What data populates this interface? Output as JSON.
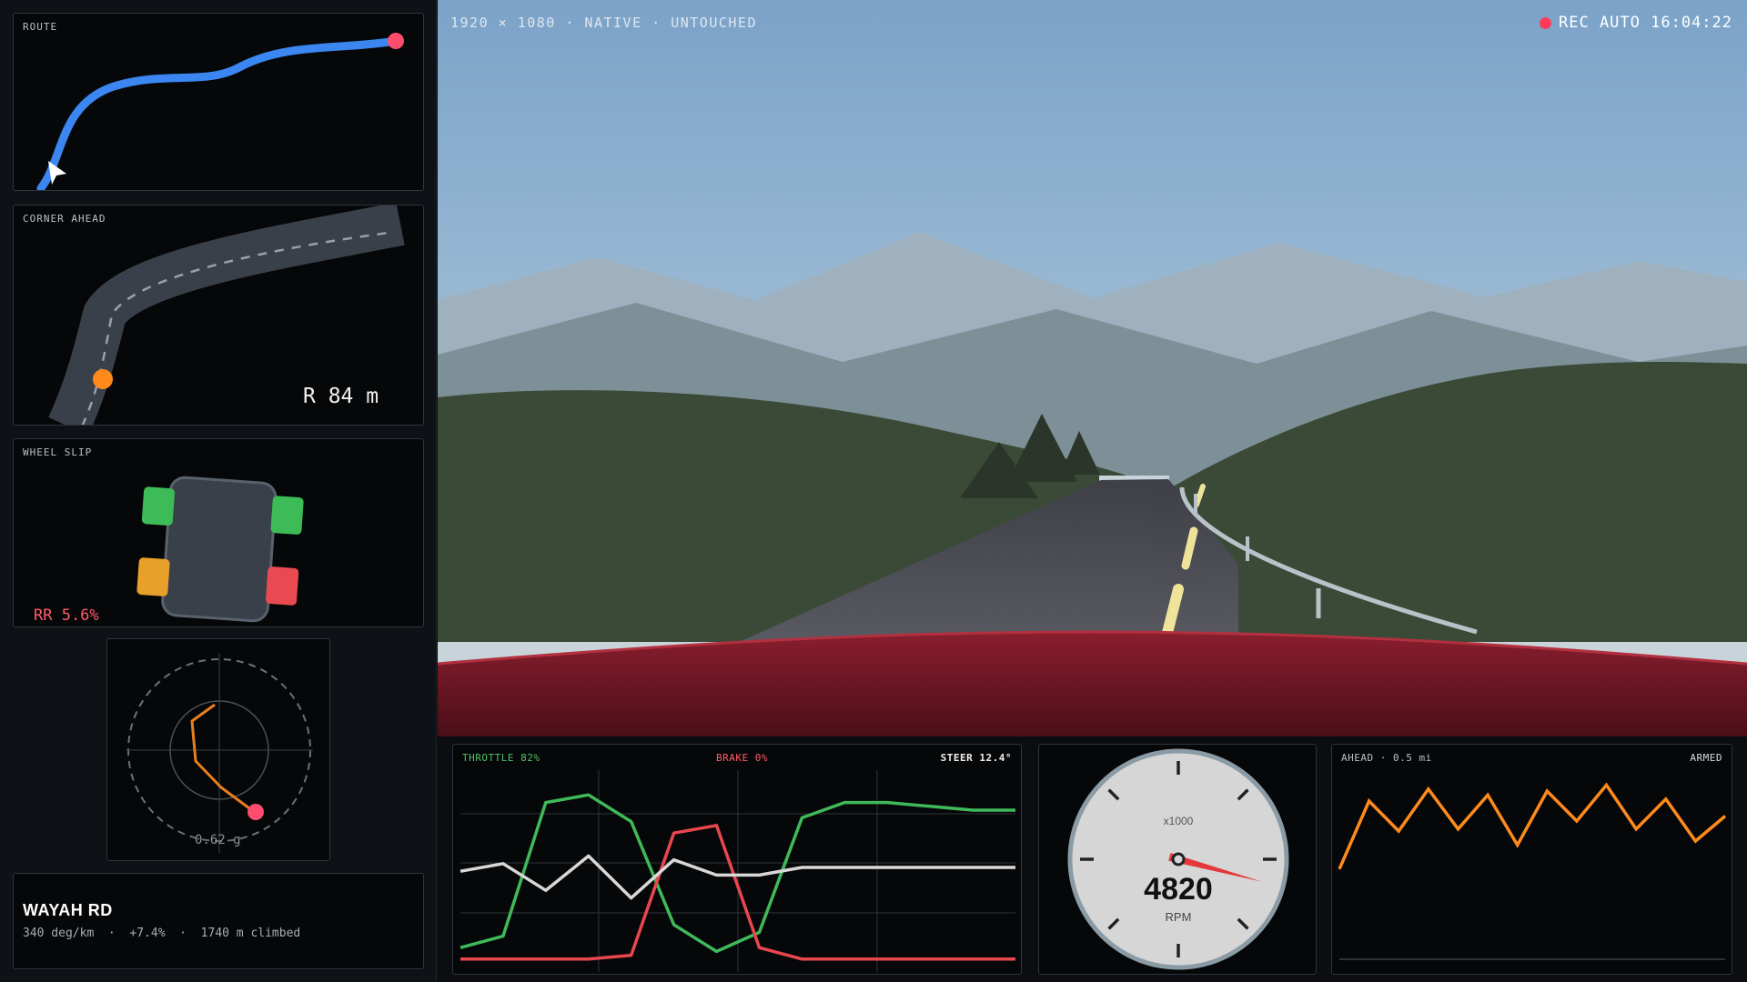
{
  "sidebar": {
    "route": {
      "label": "ROUTE"
    },
    "corner": {
      "label": "CORNER AHEAD",
      "radius": "R 84 m"
    },
    "wheel_slip": {
      "label": "WHEEL SLIP",
      "readout": "RR 5.6%",
      "wheels": {
        "FL": "#3dbb57",
        "FR": "#3dbb57",
        "RL": "#e7a02a",
        "RR": "#e94a52"
      }
    },
    "g_meter": {
      "readout": "0.62 g"
    },
    "road": {
      "name": "WAYAH RD",
      "stats": "340 deg/km  ·  +7.4%  ·  1740 m climbed"
    }
  },
  "scene": {
    "caption": "1920 × 1080 · NATIVE · UNTOUCHED",
    "rec": "REC AUTO 16:04:22"
  },
  "telemetry": {
    "throttle_label": "THROTTLE 82%",
    "brake_label": "BRAKE 0%",
    "steer_label": "STEER 12.4°",
    "chart_data": {
      "type": "line",
      "x": [
        0,
        1,
        2,
        3,
        4,
        5,
        6,
        7,
        8,
        9,
        10,
        11,
        12,
        13
      ],
      "ylim": [
        0,
        100
      ],
      "series": [
        {
          "color": "#3fb95a",
          "values": [
            8,
            14,
            84,
            88,
            74,
            20,
            6,
            16,
            76,
            84,
            84,
            82,
            80,
            80
          ]
        },
        {
          "color": "#e8474f",
          "values": [
            2,
            2,
            2,
            2,
            4,
            68,
            72,
            8,
            2,
            2,
            2,
            2,
            2,
            2
          ]
        },
        {
          "color": "#d8d8d8",
          "values": [
            48,
            52,
            38,
            56,
            34,
            54,
            46,
            46,
            50,
            50,
            50,
            50,
            50,
            50
          ]
        }
      ]
    }
  },
  "tach": {
    "value": "4820",
    "unit": "RPM",
    "scale": "x1000",
    "needle_rpm": 4820
  },
  "ahead": {
    "label": "AHEAD · 0.5 mi",
    "status": "ARMED",
    "chart_data": {
      "type": "line",
      "x": [
        0,
        1,
        2,
        3,
        4,
        5,
        6,
        7,
        8,
        9,
        10,
        11,
        12,
        13
      ],
      "values": [
        12,
        80,
        50,
        92,
        52,
        86,
        36,
        90,
        60,
        96,
        52,
        82,
        40,
        65
      ],
      "ylim": [
        0,
        100
      ]
    }
  }
}
